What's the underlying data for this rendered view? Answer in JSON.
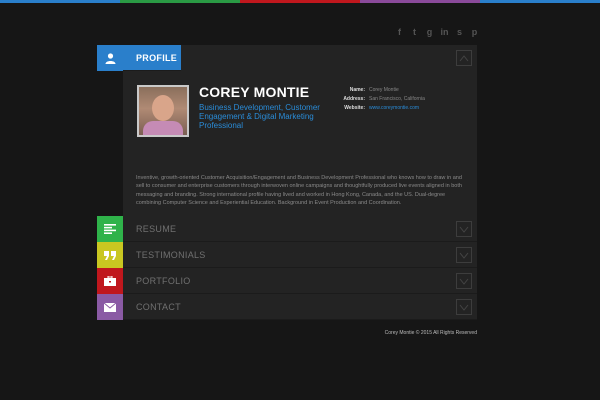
{
  "topbar_colors": [
    "#2a7fcb",
    "#2a9a44",
    "#c0171d",
    "#8a4a9a",
    "#c7c72a"
  ],
  "social": {
    "icons": [
      {
        "name": "facebook-icon",
        "glyph": "f"
      },
      {
        "name": "twitter-icon",
        "glyph": "t"
      },
      {
        "name": "google-plus-icon",
        "glyph": "g"
      },
      {
        "name": "linkedin-icon",
        "glyph": "in"
      },
      {
        "name": "skype-icon",
        "glyph": "s"
      },
      {
        "name": "pinterest-icon",
        "glyph": "p"
      }
    ]
  },
  "sections": {
    "profile": {
      "label": "PROFILE",
      "color": "#2a7fcb",
      "icon": "user-icon"
    },
    "resume": {
      "label": "RESUME",
      "color": "#2fb34a",
      "icon": "lines-icon"
    },
    "testimonials": {
      "label": "TESTIMONIALS",
      "color": "#c9c721",
      "icon": "quote-icon"
    },
    "portfolio": {
      "label": "PORTFOLIO",
      "color": "#c0171d",
      "icon": "briefcase-icon"
    },
    "contact": {
      "label": "CONTACT",
      "color": "#8a5aa4",
      "icon": "envelope-icon"
    }
  },
  "profile": {
    "name": "COREY MONTIE",
    "title": "Business Development, Customer Engagement & Digital Marketing Professional",
    "info": [
      {
        "key": "Name:",
        "value": "Corey Montie"
      },
      {
        "key": "Address:",
        "value": "San Francisco, California"
      },
      {
        "key": "Website:",
        "value": "www.coreymontie.com"
      }
    ],
    "bio": "Inventive, growth-oriented Customer Acquisition/Engagement and Business Development Professional who knows how to draw in and sell to consumer and enterprise customers through interwoven online campaigns and thoughtfully produced live events aligned in both messaging and branding. Strong international profile having lived and worked in Hong Kong, Canada, and the US. Dual-degree combining Computer Science and Experiential Education. Background in Event Production and Coordination."
  },
  "footer": "Corey Montie © 2015 All Rights Reserved"
}
